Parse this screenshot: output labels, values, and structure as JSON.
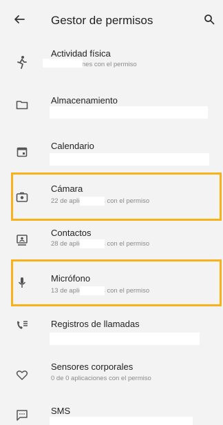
{
  "appbar": {
    "title": "Gestor de permisos",
    "back_icon": "arrow-back-icon",
    "search_icon": "search-icon"
  },
  "permissions": [
    {
      "label": "Actividad física",
      "subtitle": "3 aplicaciones con el permiso",
      "icon": "run-icon"
    },
    {
      "label": "Almacenamiento",
      "subtitle": "",
      "icon": "folder-icon"
    },
    {
      "label": "Calendario",
      "subtitle": "",
      "icon": "calendar-icon"
    },
    {
      "label": "Cámara",
      "subtitle": "22 de aplicaciones con el permiso",
      "icon": "camera-icon"
    },
    {
      "label": "Contactos",
      "subtitle": "28 de aplicaciones con el permiso",
      "icon": "contacts-icon"
    },
    {
      "label": "Micrófono",
      "subtitle": "13 de aplicaciones con el permiso",
      "icon": "microphone-icon"
    },
    {
      "label": "Registros de llamadas",
      "subtitle": "",
      "icon": "call-log-icon"
    },
    {
      "label": "Sensores corporales",
      "subtitle": "0 de 0 aplicaciones con el permiso",
      "icon": "heart-icon"
    },
    {
      "label": "SMS",
      "subtitle": "",
      "icon": "sms-icon"
    }
  ],
  "colors": {
    "background": "#f3f3f3",
    "highlight": "#f7b11b",
    "subtitle": "#8a8a8a"
  }
}
